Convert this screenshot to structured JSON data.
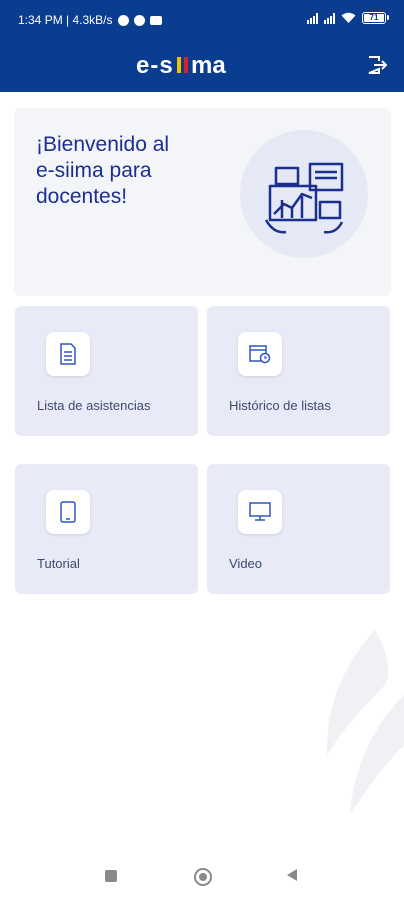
{
  "status_bar": {
    "time": "1:34 PM | 4.3kB/s",
    "battery": "71"
  },
  "header": {
    "logo_text": "e-siima"
  },
  "welcome": {
    "line1": "¡Bienvenido al",
    "line2": "e-siima para",
    "line3": "docentes!"
  },
  "tiles": [
    {
      "label": "Lista de asistencias",
      "icon": "document-list-icon"
    },
    {
      "label": "Histórico de listas",
      "icon": "calendar-history-icon"
    },
    {
      "label": "Tutorial",
      "icon": "tablet-icon"
    },
    {
      "label": "Video",
      "icon": "monitor-icon"
    }
  ],
  "colors": {
    "brand_blue": "#0a3d8f",
    "text_blue": "#1b2f8f",
    "tile_bg": "#e8ebf7",
    "logo_accent_yellow": "#f2c200",
    "logo_accent_red": "#d6212a"
  }
}
